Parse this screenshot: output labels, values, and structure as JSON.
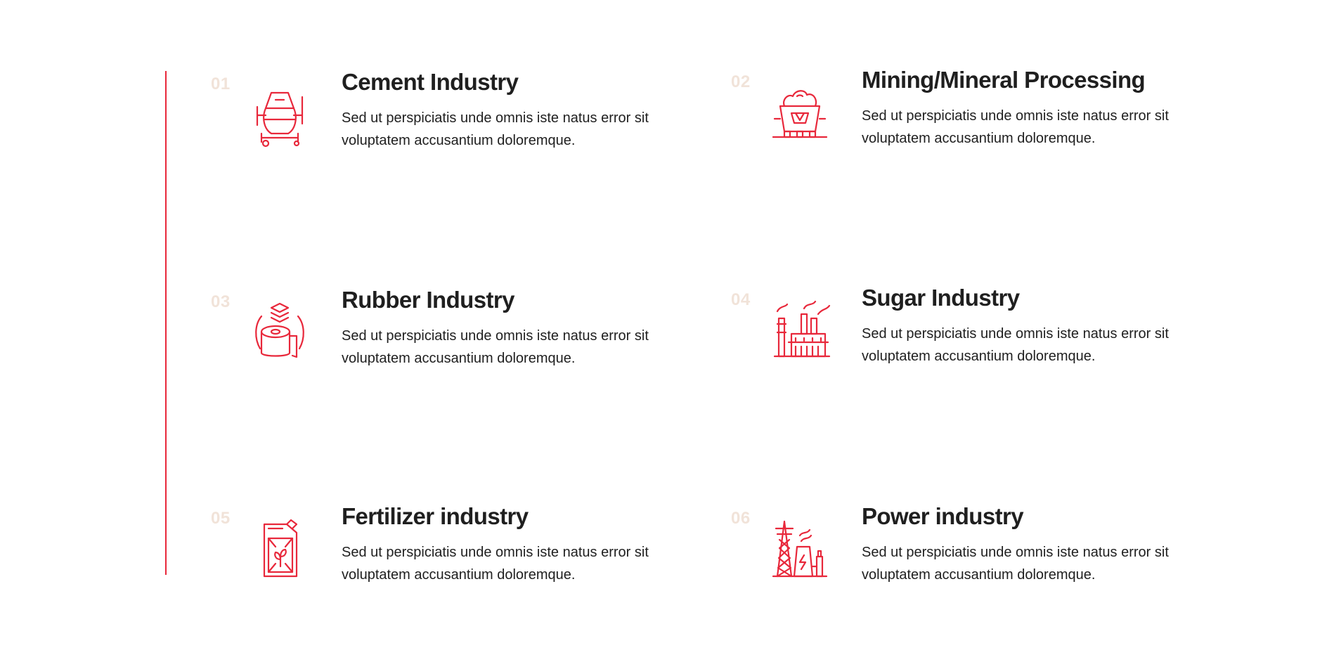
{
  "accent_color": "#e8283b",
  "number_color": "#f1e3d9",
  "items": [
    {
      "number": "01",
      "icon": "cement-mixer-icon",
      "title": "Cement Industry",
      "description": "Sed ut perspiciatis unde omnis iste natus error sit voluptatem accusantium doloremque."
    },
    {
      "number": "02",
      "icon": "mining-cart-icon",
      "title": "Mining/Mineral Processing",
      "description": "Sed ut perspiciatis unde omnis iste natus error sit voluptatem accusantium doloremque."
    },
    {
      "number": "03",
      "icon": "rubber-roll-icon",
      "title": "Rubber Industry",
      "description": "Sed ut perspiciatis unde omnis iste natus error sit voluptatem accusantium doloremque."
    },
    {
      "number": "04",
      "icon": "sugar-factory-icon",
      "title": "Sugar Industry",
      "description": "Sed ut perspiciatis unde omnis iste natus error sit voluptatem accusantium doloremque."
    },
    {
      "number": "05",
      "icon": "fertilizer-canister-icon",
      "title": "Fertilizer industry",
      "description": "Sed ut perspiciatis unde omnis iste natus error sit voluptatem accusantium doloremque."
    },
    {
      "number": "06",
      "icon": "power-plant-icon",
      "title": "Power industry",
      "description": "Sed ut perspiciatis unde omnis iste natus error sit voluptatem accusantium doloremque."
    }
  ]
}
